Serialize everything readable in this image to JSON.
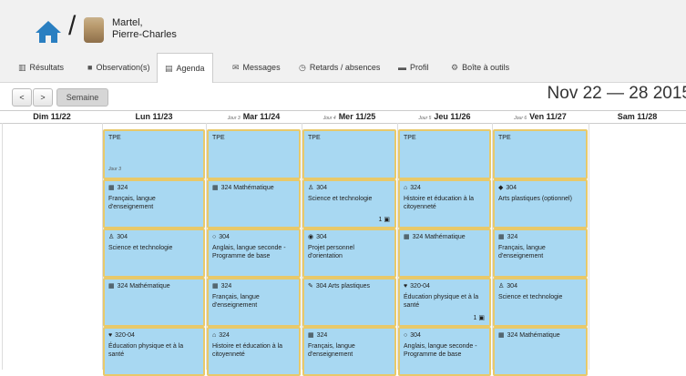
{
  "user": {
    "name_line1": "Martel,",
    "name_line2": "Pierre-Charles"
  },
  "nav": [
    {
      "icon": "▥",
      "label": "Résultats"
    },
    {
      "icon": "■",
      "label": "Observation(s)"
    },
    {
      "icon": "▤",
      "label": "Agenda"
    },
    {
      "icon": "✉",
      "label": "Messages"
    },
    {
      "icon": "◷",
      "label": "Retards / absences"
    },
    {
      "icon": "▬",
      "label": "Profil"
    },
    {
      "icon": "⚙",
      "label": "Boîte à outils"
    }
  ],
  "toolbar": {
    "prev": "<",
    "next": ">",
    "week": "Semaine",
    "range": "Nov 22 — 28 2015"
  },
  "days": [
    {
      "jour": "",
      "label": "Dim 11/22"
    },
    {
      "jour": "",
      "label": "Lun 11/23"
    },
    {
      "jour": "Jour 3",
      "label": "Mar 11/24"
    },
    {
      "jour": "Jour 4",
      "label": "Mer 11/25"
    },
    {
      "jour": "Jour 5",
      "label": "Jeu 11/26"
    },
    {
      "jour": "Jour 6",
      "label": "Ven 11/27"
    },
    {
      "jour": "",
      "label": "Sam 11/28"
    }
  ],
  "events": [
    {
      "day": 1,
      "row": 0,
      "lines": [
        "TPE"
      ],
      "sub": "Jour 3"
    },
    {
      "day": 2,
      "row": 0,
      "lines": [
        "TPE"
      ]
    },
    {
      "day": 3,
      "row": 0,
      "lines": [
        "TPE"
      ]
    },
    {
      "day": 4,
      "row": 0,
      "lines": [
        "TPE"
      ]
    },
    {
      "day": 5,
      "row": 0,
      "lines": [
        "TPE"
      ]
    },
    {
      "day": 1,
      "row": 1,
      "icon": "▦",
      "lines": [
        "324",
        "Français, langue",
        "d'enseignement"
      ]
    },
    {
      "day": 2,
      "row": 1,
      "icon": "▦",
      "lines": [
        "324 Mathématique"
      ]
    },
    {
      "day": 3,
      "row": 1,
      "icon": "♙",
      "lines": [
        "304",
        "Science et technologie"
      ],
      "count": "1 ▣"
    },
    {
      "day": 4,
      "row": 1,
      "icon": "⌂",
      "lines": [
        "324",
        "Histoire et éducation à la",
        "citoyenneté"
      ]
    },
    {
      "day": 5,
      "row": 1,
      "icon": "◆",
      "lines": [
        "304",
        "Arts plastiques (optionnel)"
      ]
    },
    {
      "day": 1,
      "row": 2,
      "icon": "♙",
      "lines": [
        "304",
        "Science et technologie"
      ]
    },
    {
      "day": 2,
      "row": 2,
      "icon": "○",
      "lines": [
        "304",
        "Anglais, langue seconde -",
        "Programme de base"
      ]
    },
    {
      "day": 3,
      "row": 2,
      "icon": "◉",
      "lines": [
        "304",
        "Projet personnel",
        "d'orientation"
      ]
    },
    {
      "day": 4,
      "row": 2,
      "icon": "▦",
      "lines": [
        "324 Mathématique"
      ]
    },
    {
      "day": 5,
      "row": 2,
      "icon": "▦",
      "lines": [
        "324",
        "Français, langue",
        "d'enseignement"
      ]
    },
    {
      "day": 1,
      "row": 3,
      "icon": "▦",
      "lines": [
        "324 Mathématique"
      ]
    },
    {
      "day": 2,
      "row": 3,
      "icon": "▦",
      "lines": [
        "324",
        "Français, langue",
        "d'enseignement"
      ]
    },
    {
      "day": 3,
      "row": 3,
      "icon": "✎",
      "lines": [
        "304 Arts plastiques"
      ]
    },
    {
      "day": 4,
      "row": 3,
      "icon": "♥",
      "lines": [
        "320-04",
        "Éducation physique et à la",
        "santé"
      ],
      "count": "1 ▣"
    },
    {
      "day": 5,
      "row": 3,
      "icon": "♙",
      "lines": [
        "304",
        "Science et technologie"
      ]
    },
    {
      "day": 1,
      "row": 4,
      "icon": "♥",
      "lines": [
        "320-04",
        "Éducation physique et à la",
        "santé"
      ]
    },
    {
      "day": 2,
      "row": 4,
      "icon": "⌂",
      "lines": [
        "324",
        "Histoire et éducation à la",
        "citoyenneté"
      ]
    },
    {
      "day": 3,
      "row": 4,
      "icon": "▦",
      "lines": [
        "324",
        "Français, langue",
        "d'enseignement"
      ]
    },
    {
      "day": 4,
      "row": 4,
      "icon": "○",
      "lines": [
        "304",
        "Anglais, langue seconde -",
        "Programme de base"
      ]
    },
    {
      "day": 5,
      "row": 4,
      "icon": "▦",
      "lines": [
        "324 Mathématique"
      ]
    }
  ]
}
